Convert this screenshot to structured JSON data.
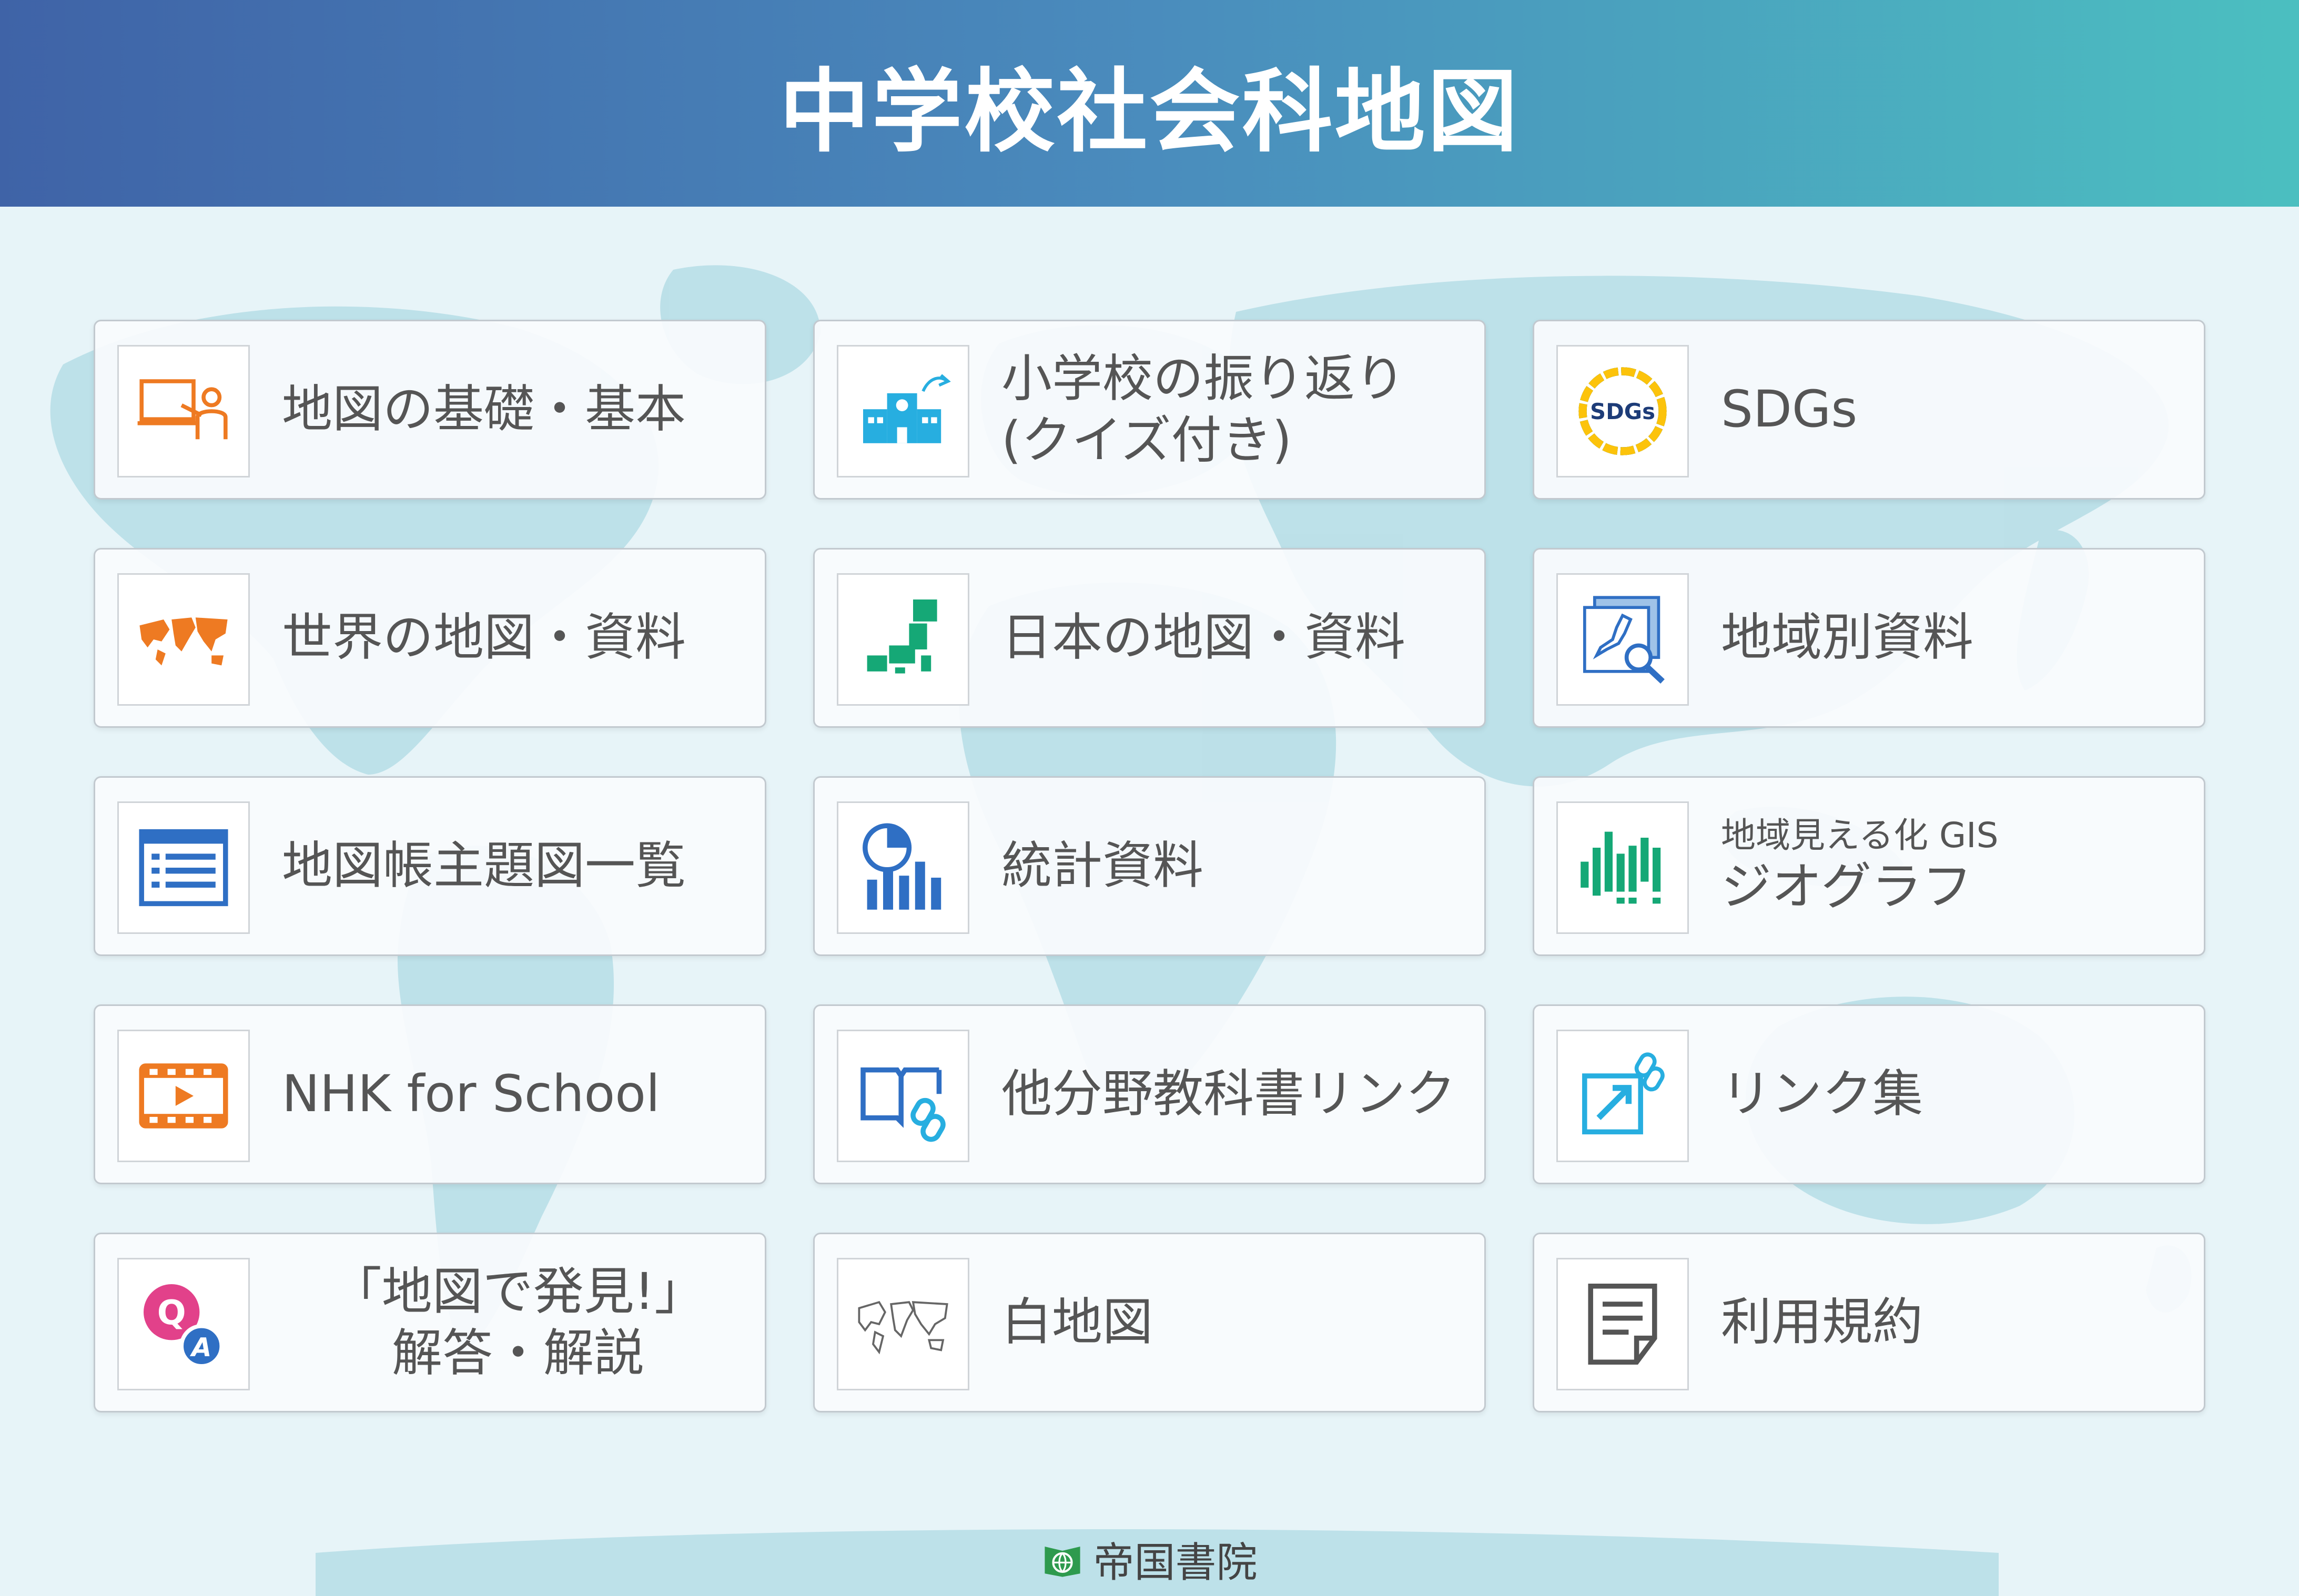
{
  "header": {
    "title": "中学校社会科地図"
  },
  "cards": [
    {
      "label": "地図の基礎・基本",
      "icon": "teacher-board-icon"
    },
    {
      "line1": "小学校の振り返り",
      "line2": "(クイズ付き)",
      "icon": "school-building-icon"
    },
    {
      "label": "SDGs",
      "icon": "sdgs-logo-icon"
    },
    {
      "label": "世界の地図・資料",
      "icon": "world-map-icon"
    },
    {
      "label": "日本の地図・資料",
      "icon": "japan-map-icon"
    },
    {
      "label": "地域別資料",
      "icon": "regional-map-search-icon"
    },
    {
      "label": "地図帳主題図一覧",
      "icon": "list-document-icon"
    },
    {
      "label": "統計資料",
      "icon": "statistics-chart-icon"
    },
    {
      "small": "地域見える化 GIS",
      "label": "ジオグラフ",
      "icon": "geograph-bars-icon"
    },
    {
      "label": "NHK for School",
      "icon": "video-film-icon"
    },
    {
      "label": "他分野教科書リンク",
      "icon": "book-link-icon"
    },
    {
      "label": "リンク集",
      "icon": "external-link-icon"
    },
    {
      "line1": "「地図で発見!」",
      "line2": "解答・解説",
      "icon": "qa-icon"
    },
    {
      "label": "白地図",
      "icon": "blank-world-map-icon"
    },
    {
      "label": "利用規約",
      "icon": "terms-document-icon"
    }
  ],
  "footer": {
    "publisher": "帝国書院"
  },
  "colors": {
    "header_start": "#3f63a7",
    "header_end": "#4bbfc0",
    "orange": "#ee7a22",
    "green": "#15a876",
    "blue": "#2f6fc4",
    "cyan": "#27aee0",
    "pink": "#e2418a"
  }
}
